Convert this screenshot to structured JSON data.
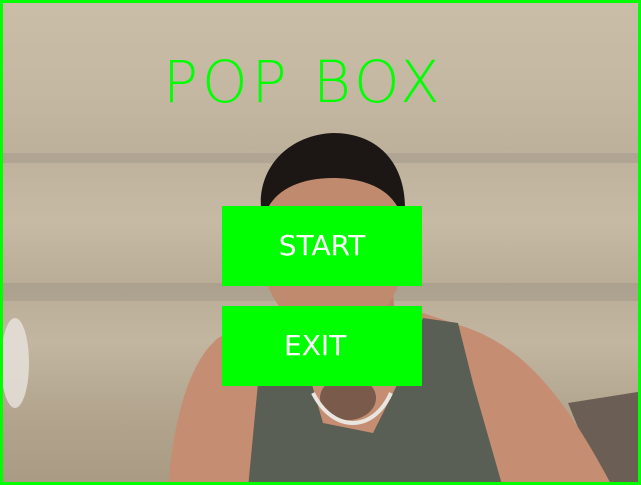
{
  "game": {
    "title": "POP BOX"
  },
  "menu": {
    "start_label": "START",
    "exit_label": "EXIT"
  },
  "colors": {
    "accent": "#00ff00",
    "button_text": "#ffffff"
  }
}
